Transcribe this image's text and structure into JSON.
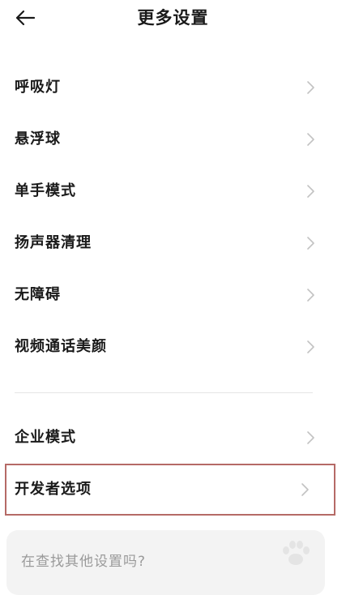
{
  "header": {
    "title": "更多设置",
    "back_icon": "arrow-left-icon"
  },
  "group1": {
    "items": [
      {
        "label": "呼吸灯"
      },
      {
        "label": "悬浮球"
      },
      {
        "label": "单手模式"
      },
      {
        "label": "扬声器清理"
      },
      {
        "label": "无障碍"
      },
      {
        "label": "视频通话美颜"
      }
    ]
  },
  "group2": {
    "items": [
      {
        "label": "企业模式"
      },
      {
        "label": "开发者选项",
        "highlighted": true
      }
    ]
  },
  "search_card": {
    "text": "在查找其他设置吗?"
  },
  "colors": {
    "text": "#1a1a1a",
    "chevron": "#c2c2c2",
    "highlight_border": "#b56a66",
    "card_bg": "#f3f3f3",
    "muted_text": "#9a9a9a"
  }
}
